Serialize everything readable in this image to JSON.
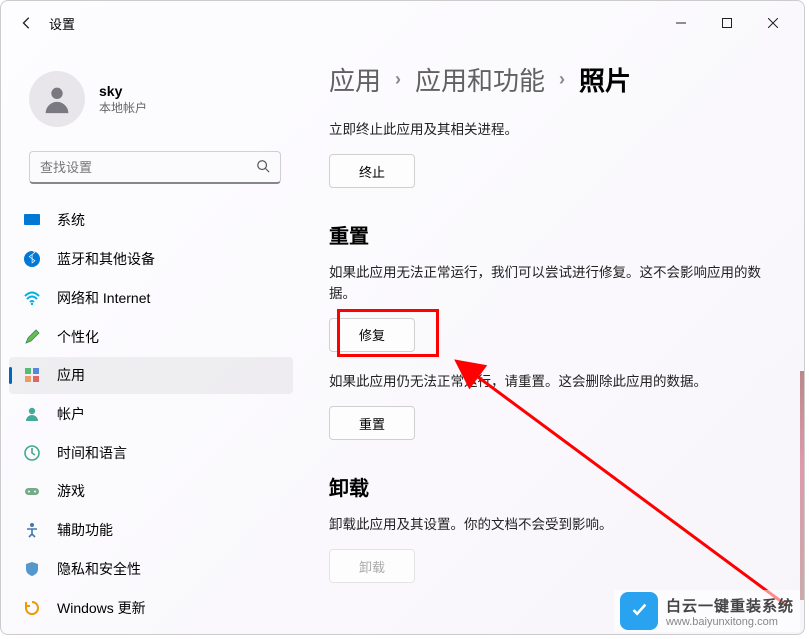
{
  "titlebar": {
    "title": "设置"
  },
  "profile": {
    "name": "sky",
    "sub": "本地帐户"
  },
  "search": {
    "placeholder": "查找设置"
  },
  "nav": {
    "items": [
      {
        "label": "系统"
      },
      {
        "label": "蓝牙和其他设备"
      },
      {
        "label": "网络和 Internet"
      },
      {
        "label": "个性化"
      },
      {
        "label": "应用"
      },
      {
        "label": "帐户"
      },
      {
        "label": "时间和语言"
      },
      {
        "label": "游戏"
      },
      {
        "label": "辅助功能"
      },
      {
        "label": "隐私和安全性"
      },
      {
        "label": "Windows 更新"
      }
    ]
  },
  "breadcrumb": {
    "a": "应用",
    "b": "应用和功能",
    "c": "照片"
  },
  "sec_terminate": {
    "text": "立即终止此应用及其相关进程。",
    "btn": "终止"
  },
  "sec_reset": {
    "title": "重置",
    "text1": "如果此应用无法正常运行，我们可以尝试进行修复。这不会影响应用的数据。",
    "btn1": "修复",
    "text2": "如果此应用仍无法正常运行，请重置。这会删除此应用的数据。",
    "btn2": "重置"
  },
  "sec_uninstall": {
    "title": "卸载",
    "text": "卸载此应用及其设置。你的文档不会受到影响。",
    "btn": "卸载"
  },
  "watermark": {
    "line1": "白云一键重装系统",
    "line2": "www.baiyunxitong.com"
  }
}
